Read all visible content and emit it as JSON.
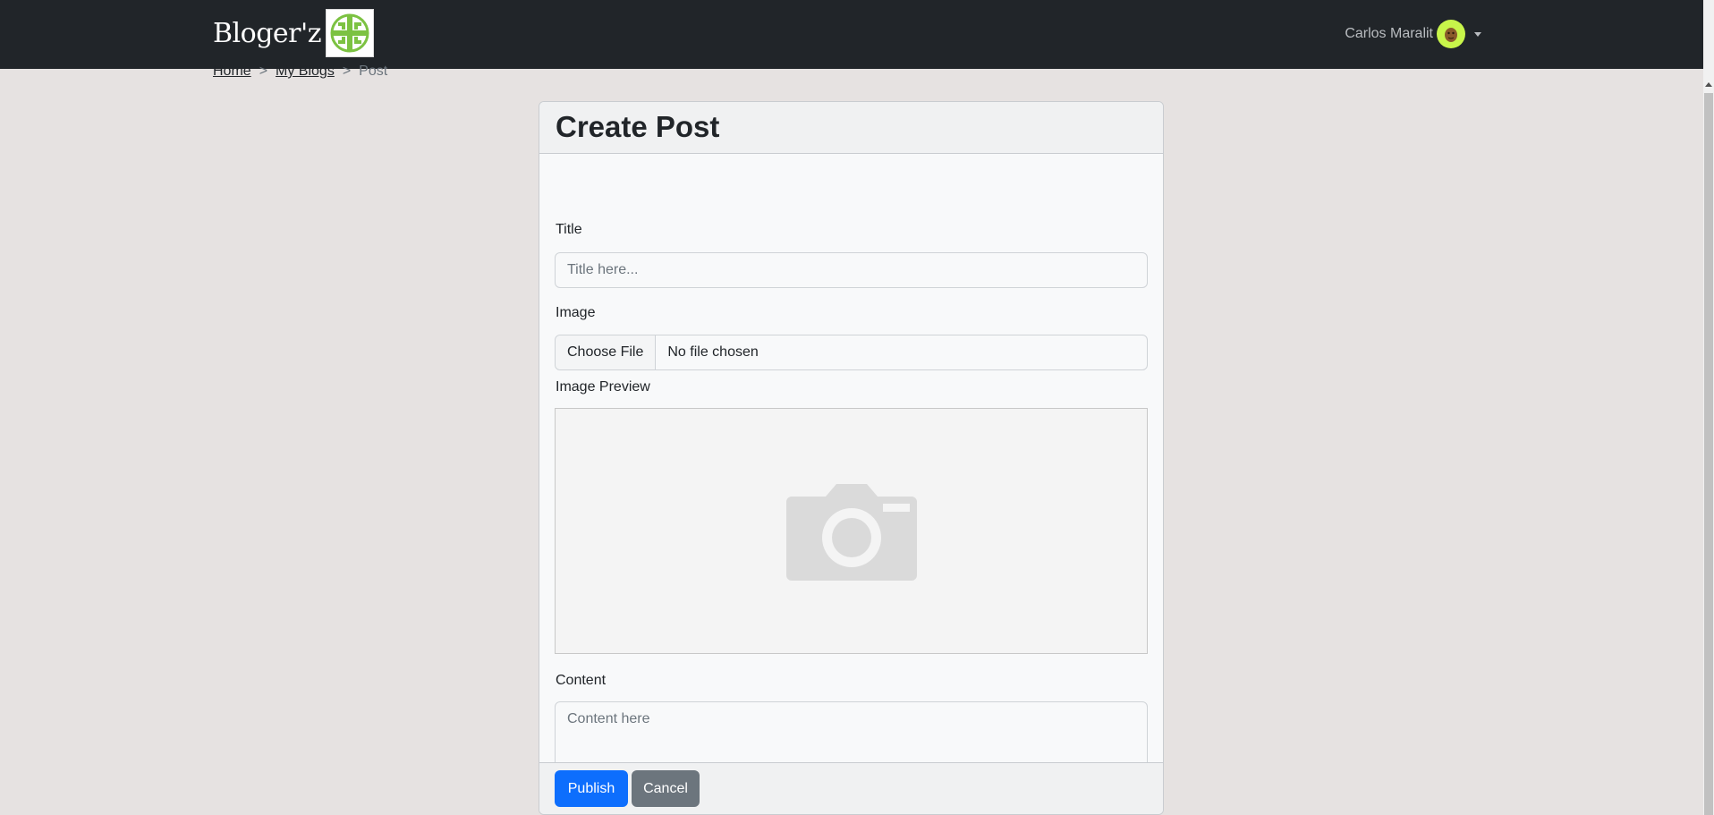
{
  "navbar": {
    "brand": "Bloger'z",
    "user_name": "Carlos Maralit"
  },
  "breadcrumb": {
    "home": "Home",
    "sep1": ">",
    "my_blogs": "My Blogs",
    "sep2": ">",
    "current": "Post"
  },
  "form": {
    "header": "Create Post",
    "title_label": "Title",
    "title_placeholder": "Title here...",
    "image_label": "Image",
    "choose_file": "Choose File",
    "file_status": "No file chosen",
    "preview_label": "Image Preview",
    "content_label": "Content",
    "content_placeholder": "Content here"
  },
  "buttons": {
    "publish": "Publish",
    "cancel": "Cancel"
  },
  "colors": {
    "navbar": "#212529",
    "primary": "#0d6efd",
    "secondary": "#6c757d",
    "background": "#e6e2e1",
    "avatar": "#c8f54a"
  },
  "icons": {
    "brand_logo": "celtic-knot-logo",
    "avatar": "user-avatar",
    "caret": "caret-down-icon",
    "preview": "camera-icon"
  }
}
